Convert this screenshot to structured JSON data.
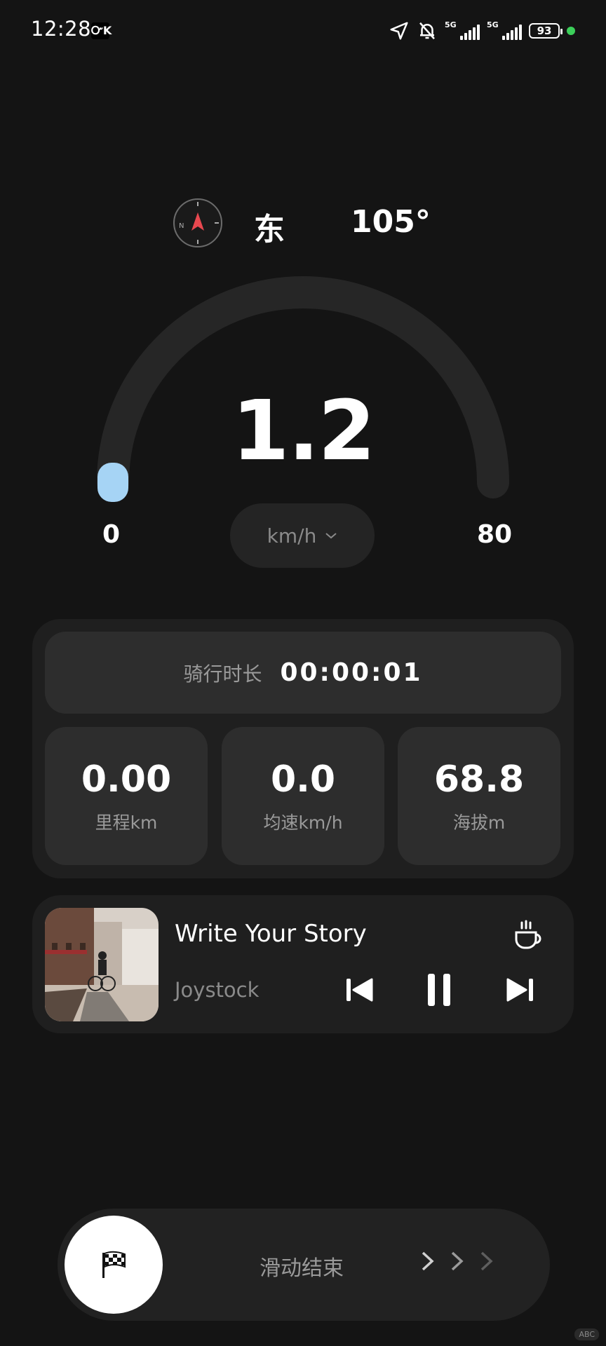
{
  "status_bar": {
    "time": "12:28",
    "app_badge": "ᏅK",
    "network_1": "5G",
    "network_2": "5G",
    "battery": "93"
  },
  "compass": {
    "direction": "东",
    "heading": "105°"
  },
  "speedometer": {
    "speed": "1.2",
    "min": "0",
    "max": "80",
    "unit": "km/h",
    "level": 0.015,
    "accent_color": "#a6d4f5"
  },
  "stats": {
    "duration_label": "骑行时长",
    "duration_value": "00:00:01",
    "items": [
      {
        "value": "0.00",
        "label": "里程km"
      },
      {
        "value": "0.0",
        "label": "均速km/h"
      },
      {
        "value": "68.8",
        "label": "海拔m"
      }
    ]
  },
  "music": {
    "title": "Write Your Story",
    "artist": "Joystock",
    "icons": [
      "coffee-icon",
      "previous-icon",
      "pause-icon",
      "next-icon"
    ]
  },
  "end_slider": {
    "label": "滑动结束",
    "icon": "checkered-flag-icon"
  },
  "corner_badge": "ABC"
}
